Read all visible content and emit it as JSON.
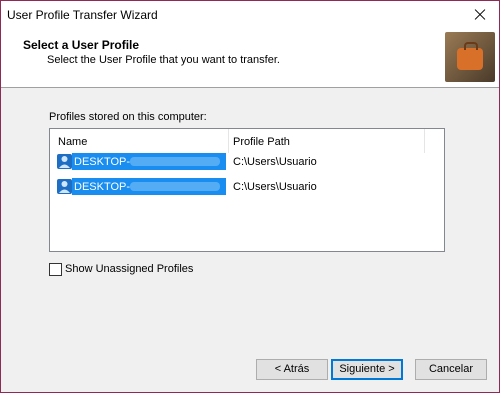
{
  "window": {
    "title": "User Profile Transfer Wizard"
  },
  "header": {
    "title": "Select a User Profile",
    "subtitle": "Select the User Profile that you want to transfer."
  },
  "profiles": {
    "label": "Profiles stored on this computer:",
    "columns": {
      "name": "Name",
      "path": "Profile Path"
    },
    "rows": [
      {
        "name": "DESKTOP-",
        "path": "C:\\Users\\Usuario"
      },
      {
        "name": "DESKTOP-",
        "path": "C:\\Users\\Usuario"
      }
    ]
  },
  "options": {
    "show_unassigned": "Show Unassigned Profiles"
  },
  "buttons": {
    "back": "< Atrás",
    "next": "Siguiente >",
    "cancel": "Cancelar"
  },
  "colors": {
    "selection": "#1a8df0",
    "border_accent": "#8f2a55"
  }
}
